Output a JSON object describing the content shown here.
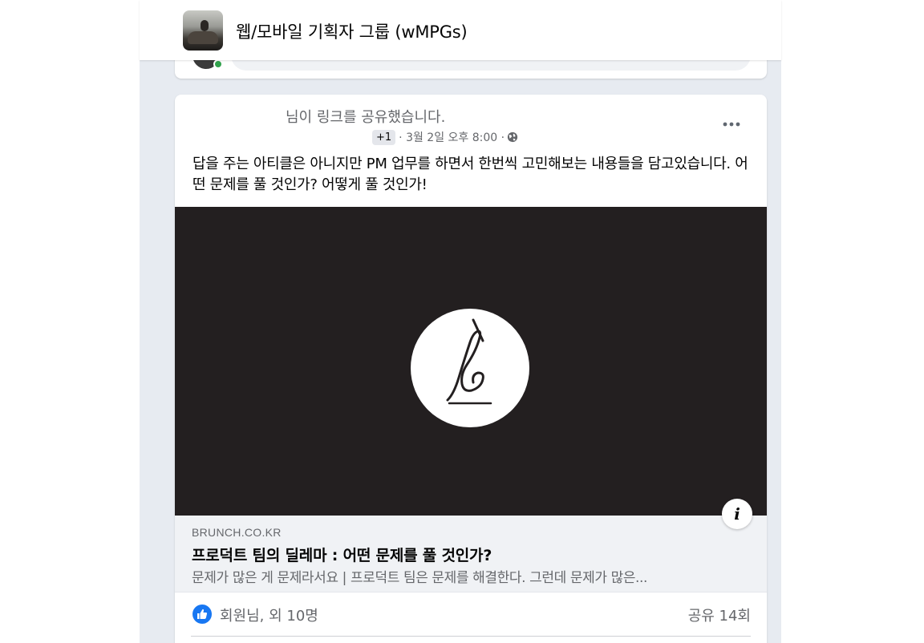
{
  "group": {
    "title": "웹/모바일 기획자 그룹 (wMPGs)"
  },
  "post": {
    "headline": "님이 링크를 공유했습니다.",
    "plus_badge": "+1",
    "timestamp": "· 3월 2일 오후 8:00 ·",
    "text": "답을 주는 아티클은 아니지만 PM 업무를 하면서 한번씩 고민해보는 내용들을 담고있습니다. 어떤 문제를 풀 것인가? 어떻게 풀 것인가!"
  },
  "link": {
    "domain": "BRUNCH.CO.KR",
    "title": "프로덕트 팀의 딜레마 : 어떤 문제를 풀 것인가?",
    "description": "문제가 많은 게 문제라서요 | 프로덕트 팀은 문제를 해결한다. 그런데 문제가 많은..."
  },
  "reactions": {
    "summary": "회원님, 외 10명",
    "shares": "공유 14회"
  },
  "icons": {
    "more": "more-icon",
    "globe": "globe-icon",
    "info": "info-icon",
    "like": "like-icon",
    "brand_logo": "brunch-logo-icon"
  },
  "colors": {
    "like_blue": "#1877f2",
    "online_green": "#31a24c",
    "feed_background": "#e7ebf1",
    "image_background": "#231f20"
  }
}
